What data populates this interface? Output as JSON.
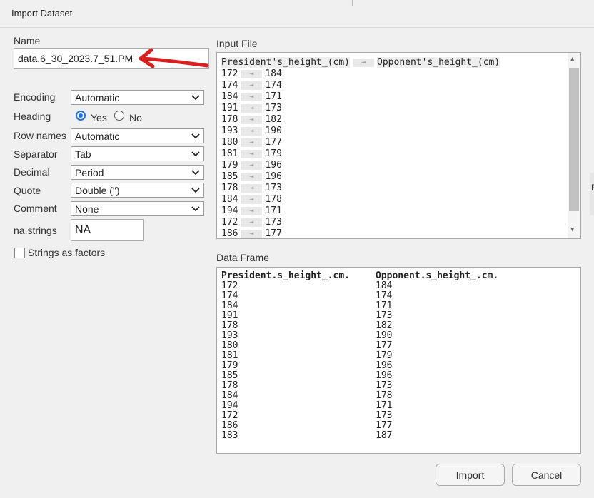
{
  "dialog": {
    "title": "Import Dataset"
  },
  "name": {
    "label": "Name",
    "value": "data.6_30_2023.7_51.PM"
  },
  "options": {
    "encoding": {
      "label": "Encoding",
      "value": "Automatic"
    },
    "heading": {
      "label": "Heading",
      "yes": "Yes",
      "no": "No",
      "selected": "Yes"
    },
    "row_names": {
      "label": "Row names",
      "value": "Automatic"
    },
    "separator": {
      "label": "Separator",
      "value": "Tab"
    },
    "decimal": {
      "label": "Decimal",
      "value": "Period"
    },
    "quote": {
      "label": "Quote",
      "value": "Double (\")"
    },
    "comment": {
      "label": "Comment",
      "value": "None"
    },
    "na_strings": {
      "label": "na.strings",
      "value": "NA"
    },
    "strings_as_factors": {
      "label": "Strings as factors",
      "checked": false
    }
  },
  "input_file": {
    "label": "Input File",
    "header": [
      "President's_height_(cm)",
      "Opponent's_height_(cm)"
    ],
    "tab_glyph": "⇥",
    "rows": [
      [
        "172",
        "184"
      ],
      [
        "174",
        "174"
      ],
      [
        "184",
        "171"
      ],
      [
        "191",
        "173"
      ],
      [
        "178",
        "182"
      ],
      [
        "193",
        "190"
      ],
      [
        "180",
        "177"
      ],
      [
        "181",
        "179"
      ],
      [
        "179",
        "196"
      ],
      [
        "185",
        "196"
      ],
      [
        "178",
        "173"
      ],
      [
        "184",
        "178"
      ],
      [
        "194",
        "171"
      ],
      [
        "172",
        "173"
      ],
      [
        "186",
        "177"
      ]
    ]
  },
  "data_frame": {
    "label": "Data Frame",
    "columns": [
      "President.s_height_.cm.",
      "Opponent.s_height_.cm."
    ],
    "rows": [
      [
        "172",
        "184"
      ],
      [
        "174",
        "174"
      ],
      [
        "184",
        "171"
      ],
      [
        "191",
        "173"
      ],
      [
        "178",
        "182"
      ],
      [
        "193",
        "190"
      ],
      [
        "180",
        "177"
      ],
      [
        "181",
        "179"
      ],
      [
        "179",
        "196"
      ],
      [
        "185",
        "196"
      ],
      [
        "178",
        "173"
      ],
      [
        "184",
        "178"
      ],
      [
        "194",
        "171"
      ],
      [
        "172",
        "173"
      ],
      [
        "186",
        "177"
      ],
      [
        "183",
        "187"
      ]
    ]
  },
  "buttons": {
    "import": "Import",
    "cancel": "Cancel"
  },
  "colors": {
    "annotation_arrow": "#d92020",
    "radio_accent": "#1a73e8"
  }
}
